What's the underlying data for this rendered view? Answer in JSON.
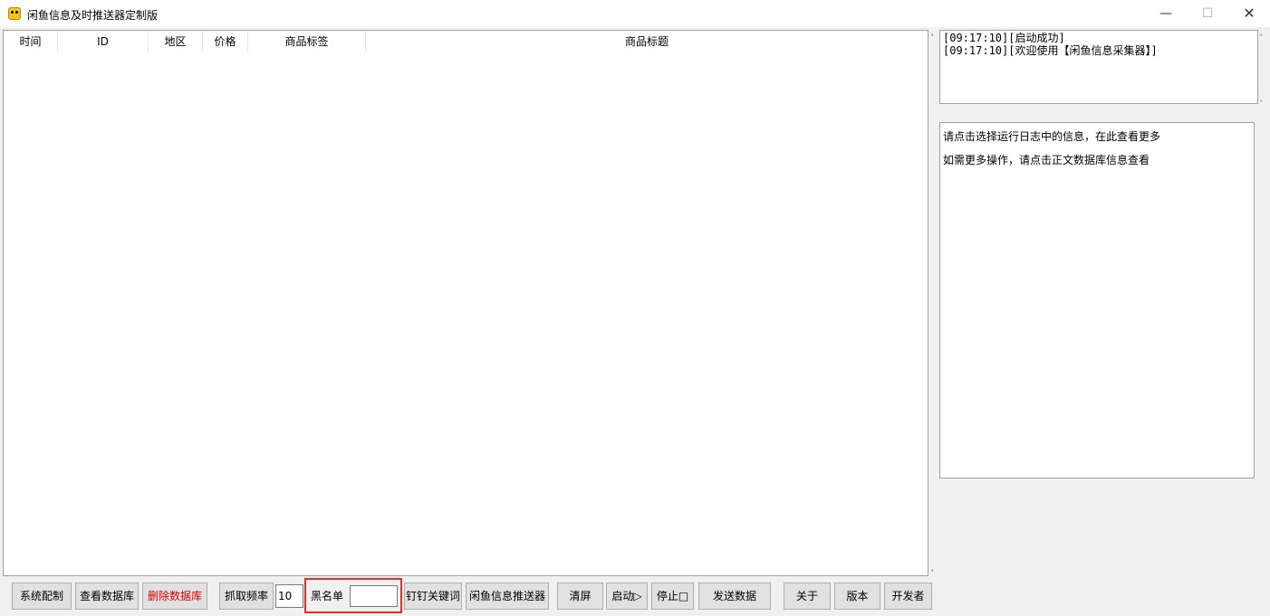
{
  "window": {
    "title": "闲鱼信息及时推送器定制版",
    "minimize": "—",
    "maximize": "☐",
    "close": "✕"
  },
  "table": {
    "columns": [
      "时间",
      "ID",
      "地区",
      "价格",
      "商品标签",
      "商品标题"
    ],
    "rows": []
  },
  "log": {
    "lines": [
      "[09:17:10][启动成功]",
      "[09:17:10][欢迎使用【闲鱼信息采集器】]"
    ]
  },
  "detail": {
    "lines": [
      "请点击选择运行日志中的信息，在此查看更多",
      "如需更多操作，请点击正文数据库信息查看"
    ]
  },
  "toolbar": {
    "system_config": "系统配制",
    "view_db": "查看数据库",
    "delete_db": "删除数据库",
    "fetch_freq": "抓取频率",
    "freq_value": "10",
    "blacklist": "黑名单",
    "blacklist_value": "",
    "dingtalk_keyword": "钉钉关键词",
    "pusher_name": "闲鱼信息推送器",
    "clear_screen": "清屏",
    "start": "启动▷",
    "stop": "停止□",
    "send_data": "发送数据",
    "about": "关于",
    "version": "版本",
    "developer": "开发者"
  },
  "colors": {
    "delete_text": "#e00000",
    "highlight": "#e03030"
  }
}
